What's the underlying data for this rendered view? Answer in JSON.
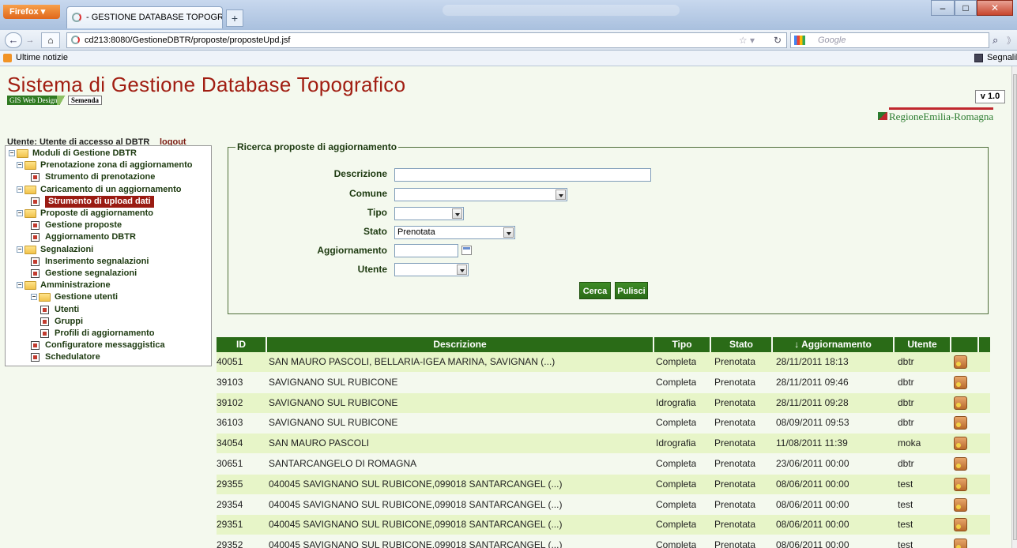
{
  "browser": {
    "menu_button": "Firefox",
    "tab_title": "- GESTIONE DATABASE TOPOGRAFICO ...",
    "new_tab": "+",
    "url": "cd213:8080/GestioneDBTR/proposte/proposteUpd.jsf",
    "search_engine": "Google",
    "bookmark_left": "Ultime notizie",
    "bookmark_right": "Segnalibri"
  },
  "header": {
    "title": "Sistema di Gestione Database Topografico",
    "logo_gis": "GIS Web Design",
    "logo_semenda": "Semenda",
    "version": "v 1.0",
    "region_logo": "RegioneEmilia-Romagna",
    "user_line": "Utente: Utente di accesso al DBTR",
    "logout": "logout"
  },
  "menu": [
    {
      "label": "Moduli di Gestione DBTR",
      "type": "folder",
      "level": 0
    },
    {
      "label": "Prenotazione zona di aggiornamento",
      "type": "folder",
      "level": 1
    },
    {
      "label": "Strumento di prenotazione",
      "type": "doc",
      "level": 2
    },
    {
      "label": "Caricamento di un aggiornamento",
      "type": "folder",
      "level": 1
    },
    {
      "label": "Strumento di upload dati",
      "type": "doc",
      "level": 2,
      "selected": true
    },
    {
      "label": "Proposte di aggiornamento",
      "type": "folder",
      "level": 1
    },
    {
      "label": "Gestione proposte",
      "type": "doc",
      "level": 2
    },
    {
      "label": "Aggiornamento DBTR",
      "type": "doc",
      "level": 2
    },
    {
      "label": "Segnalazioni",
      "type": "folder",
      "level": 1
    },
    {
      "label": "Inserimento segnalazioni",
      "type": "doc",
      "level": 2
    },
    {
      "label": "Gestione segnalazioni",
      "type": "doc",
      "level": 2
    },
    {
      "label": "Amministrazione",
      "type": "folder",
      "level": 1
    },
    {
      "label": "Gestione utenti",
      "type": "folder",
      "level": 2
    },
    {
      "label": "Utenti",
      "type": "doc",
      "level": 3
    },
    {
      "label": "Gruppi",
      "type": "doc",
      "level": 3
    },
    {
      "label": "Profili di aggiornamento",
      "type": "doc",
      "level": 3
    },
    {
      "label": "Configuratore messaggistica",
      "type": "doc",
      "level": 2
    },
    {
      "label": "Schedulatore",
      "type": "doc",
      "level": 2
    }
  ],
  "search": {
    "legend": "Ricerca proposte di aggiornamento",
    "labels": {
      "descrizione": "Descrizione",
      "comune": "Comune",
      "tipo": "Tipo",
      "stato": "Stato",
      "aggiornamento": "Aggiornamento",
      "utente": "Utente"
    },
    "values": {
      "descrizione": "",
      "comune": "",
      "tipo": "",
      "stato": "Prenotata",
      "aggiornamento": "",
      "utente": ""
    },
    "buttons": {
      "cerca": "Cerca",
      "pulisci": "Pulisci"
    }
  },
  "table": {
    "headers": {
      "id": "ID",
      "descrizione": "Descrizione",
      "tipo": "Tipo",
      "stato": "Stato",
      "aggiornamento": "↓ Aggiornamento",
      "utente": "Utente"
    },
    "rows": [
      {
        "id": "40051",
        "descrizione": "SAN MAURO PASCOLI, BELLARIA-IGEA MARINA, SAVIGNAN (...)",
        "tipo": "Completa",
        "stato": "Prenotata",
        "aggiornamento": "28/11/2011 18:13",
        "utente": "dbtr"
      },
      {
        "id": "39103",
        "descrizione": "SAVIGNANO SUL RUBICONE",
        "tipo": "Completa",
        "stato": "Prenotata",
        "aggiornamento": "28/11/2011 09:46",
        "utente": "dbtr"
      },
      {
        "id": "39102",
        "descrizione": "SAVIGNANO SUL RUBICONE",
        "tipo": "Idrografia",
        "stato": "Prenotata",
        "aggiornamento": "28/11/2011 09:28",
        "utente": "dbtr"
      },
      {
        "id": "36103",
        "descrizione": "SAVIGNANO SUL RUBICONE",
        "tipo": "Completa",
        "stato": "Prenotata",
        "aggiornamento": "08/09/2011 09:53",
        "utente": "dbtr"
      },
      {
        "id": "34054",
        "descrizione": "SAN MAURO PASCOLI",
        "tipo": "Idrografia",
        "stato": "Prenotata",
        "aggiornamento": "11/08/2011 11:39",
        "utente": "moka"
      },
      {
        "id": "30651",
        "descrizione": "SANTARCANGELO DI ROMAGNA",
        "tipo": "Completa",
        "stato": "Prenotata",
        "aggiornamento": "23/06/2011 00:00",
        "utente": "dbtr"
      },
      {
        "id": "29355",
        "descrizione": "040045 SAVIGNANO SUL RUBICONE,099018 SANTARCANGEL (...)",
        "tipo": "Completa",
        "stato": "Prenotata",
        "aggiornamento": "08/06/2011 00:00",
        "utente": "test"
      },
      {
        "id": "29354",
        "descrizione": "040045 SAVIGNANO SUL RUBICONE,099018 SANTARCANGEL (...)",
        "tipo": "Completa",
        "stato": "Prenotata",
        "aggiornamento": "08/06/2011 00:00",
        "utente": "test"
      },
      {
        "id": "29351",
        "descrizione": "040045 SAVIGNANO SUL RUBICONE,099018 SANTARCANGEL (...)",
        "tipo": "Completa",
        "stato": "Prenotata",
        "aggiornamento": "08/06/2011 00:00",
        "utente": "test"
      },
      {
        "id": "29352",
        "descrizione": "040045 SAVIGNANO SUL RUBICONE,099018 SANTARCANGEL (...)",
        "tipo": "Completa",
        "stato": "Prenotata",
        "aggiornamento": "08/06/2011 00:00",
        "utente": "test"
      }
    ]
  },
  "colors": {
    "title_red": "#a11e12",
    "header_green": "#2a6b17",
    "row_light": "#e7f5c8",
    "page_bg": "#f4f9ee"
  }
}
